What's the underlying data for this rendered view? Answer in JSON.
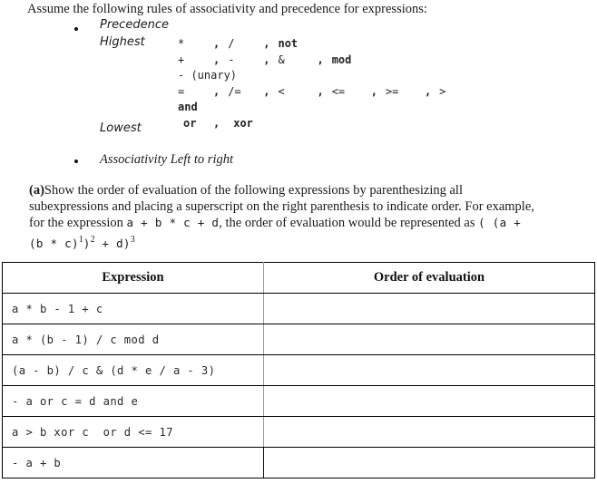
{
  "document": {
    "intro": "Assume the following rules of associativity and precedence for expressions:",
    "bullets": {
      "precedence_label": "Precedence",
      "highest_label": "Highest",
      "lowest_label": "Lowest",
      "associativity_line": "Associativity Left to right"
    },
    "precedence_rows": [
      {
        "ops": [
          "*",
          "/",
          "not"
        ],
        "bold": [
          false,
          false,
          true
        ]
      },
      {
        "ops": [
          "+",
          "-",
          "&",
          "mod"
        ],
        "bold": [
          false,
          false,
          false,
          true
        ]
      },
      {
        "ops": [
          "- (unary)"
        ],
        "bold": [
          false
        ]
      },
      {
        "ops": [
          "=",
          "/=",
          "<",
          "<=",
          ">=",
          ">"
        ],
        "bold": [
          false,
          false,
          false,
          false,
          false,
          false
        ]
      },
      {
        "ops": [
          "and"
        ],
        "bold": [
          true
        ]
      },
      {
        "ops": [
          "or",
          "xor"
        ],
        "bold": [
          true,
          true
        ]
      }
    ],
    "question": {
      "marker": "(a)",
      "text_part1": "Show the order of evaluation of the following expressions by parenthesizing all subexpressions and placing a superscript on the right parenthesis to indicate order. For example, for the expression ",
      "example_expression": "a  +  b  *  c  +  d",
      "text_part2": ", the order of evaluation would be represented as ",
      "result_open": "( (a  +  (b  *  c)",
      "result_sup1": "1",
      "result_mid": ")",
      "result_sup2": "2",
      "result_tail": "  +  d)",
      "result_sup3": "3"
    },
    "table": {
      "headers": [
        "Expression",
        "Order of evaluation"
      ],
      "rows": [
        {
          "expression": "a * b - 1 + c",
          "order": ""
        },
        {
          "expression": "a * (b - 1) / c mod d",
          "order": ""
        },
        {
          "expression": "(a - b) / c & (d * e / a - 3)",
          "order": ""
        },
        {
          "expression": "- a or c = d and e",
          "order": ""
        },
        {
          "expression": "a > b xor c  or d <= 17",
          "order": ""
        },
        {
          "expression": "- a + b",
          "order": ""
        }
      ]
    },
    "colors": {
      "text": "#1b1b1b",
      "border": "#000000",
      "inner_divider": "#9b9b9b",
      "background": "#ffffff"
    }
  }
}
